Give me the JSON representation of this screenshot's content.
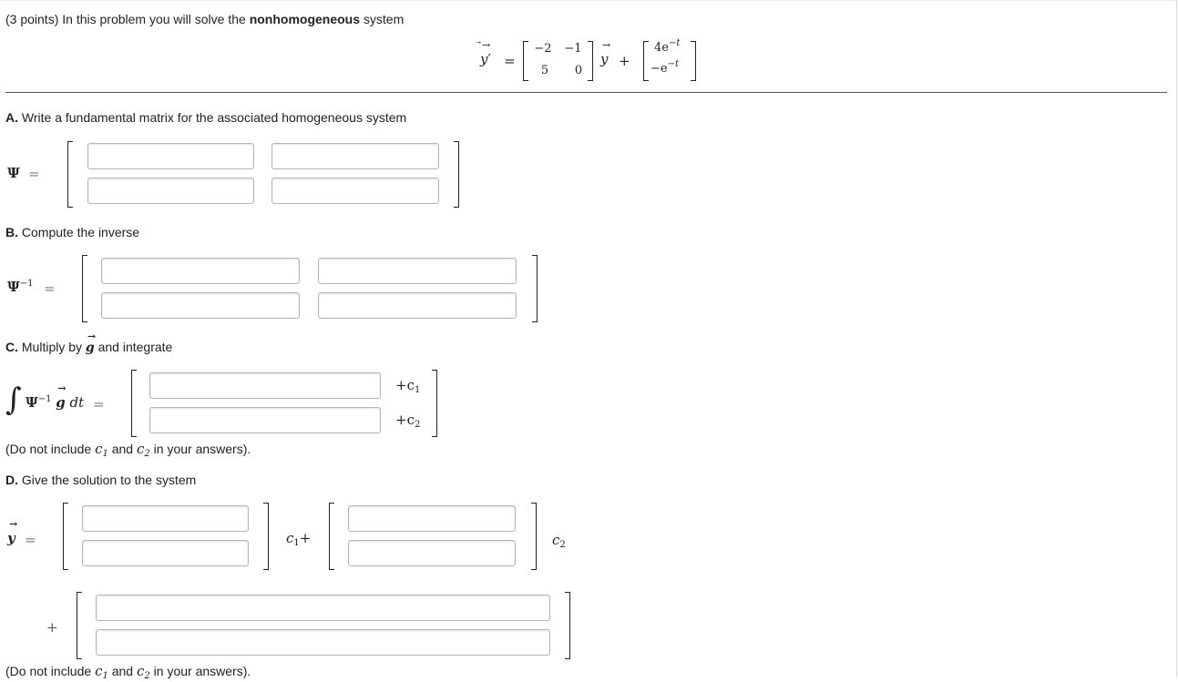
{
  "header": {
    "points": "(3 points)",
    "intro": "In this problem you will solve the",
    "keyword": "nonhomogeneous",
    "tail": "system"
  },
  "system": {
    "lhs": "y",
    "equals": "=",
    "A": [
      [
        "−2",
        "−1"
      ],
      [
        "5",
        "0"
      ]
    ],
    "plus": "+",
    "g": [
      "4e",
      "−e"
    ],
    "exp": "−t"
  },
  "partA": {
    "letter": "A.",
    "text": "Write a fundamental matrix for the associated homogeneous system",
    "lhs": "Ψ",
    "eq": "="
  },
  "partB": {
    "letter": "B.",
    "text": "Compute the inverse",
    "lhs": "Ψ",
    "exp": "−1",
    "eq": "="
  },
  "partC": {
    "letter": "C.",
    "text_before": "Multiply by",
    "g": "g",
    "text_after": "and integrate",
    "integral": "∫",
    "psi": "Ψ",
    "exp": "−1",
    "dt": "dt",
    "eq": "=",
    "c1": "+c",
    "c2": "+c",
    "sub1": "1",
    "sub2": "2"
  },
  "note1": {
    "before": "(Do not include",
    "c": "c",
    "sub1": "1",
    "and": "and",
    "sub2": "2",
    "after": "in your answers)."
  },
  "partD": {
    "letter": "D.",
    "text": "Give the solution to the system",
    "lhs": "y",
    "eq": "=",
    "c1": "c",
    "sub1": "1",
    "plus": "+",
    "c2": "c",
    "sub2": "2",
    "plus2": "+"
  },
  "note2": {
    "before": "(Do not include",
    "c": "c",
    "sub1": "1",
    "and": "and",
    "sub2": "2",
    "after": "in your answers)."
  },
  "inputs": {
    "a11": "",
    "a12": "",
    "a21": "",
    "a22": "",
    "b11": "",
    "b12": "",
    "b21": "",
    "b22": "",
    "c1": "",
    "c2": "",
    "d11": "",
    "d21": "",
    "d12": "",
    "d22": "",
    "p1": "",
    "p2": ""
  }
}
